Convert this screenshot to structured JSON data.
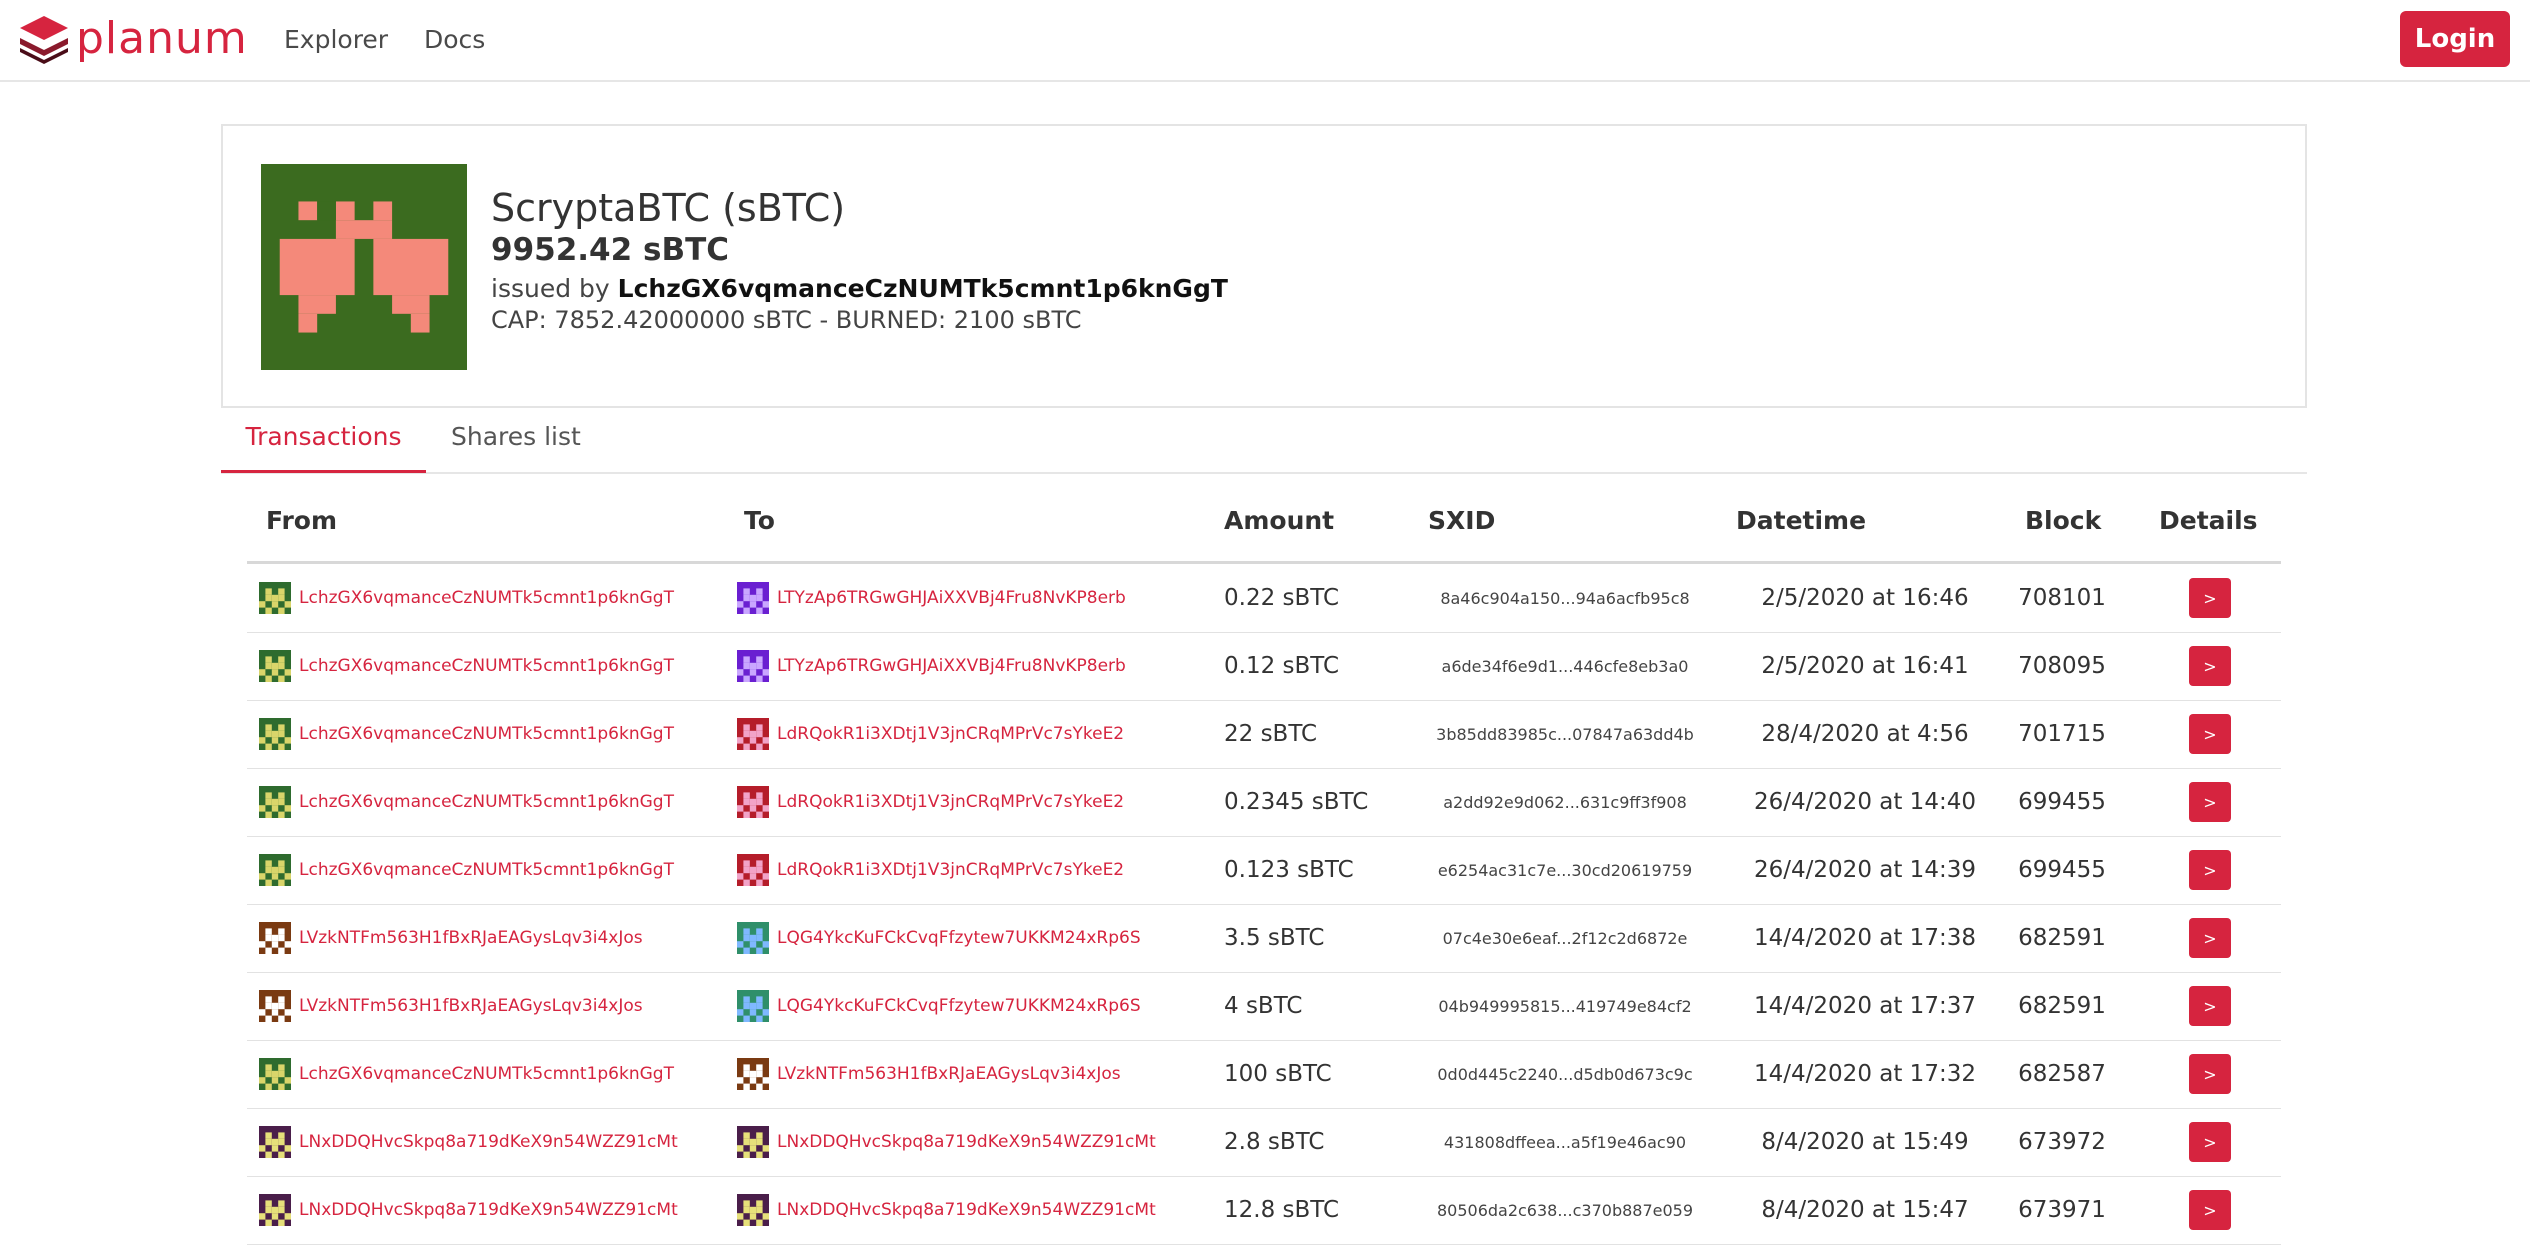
{
  "header": {
    "logo_text": "planum",
    "nav": {
      "explorer": "Explorer",
      "docs": "Docs"
    },
    "login_label": "Login"
  },
  "token": {
    "name": "ScryptaBTC (sBTC)",
    "supply": "9952.42 sBTC",
    "issued_prefix": "issued by",
    "issuer": "LchzGX6vqmanceCzNUMTk5cmnt1p6knGgT",
    "cap_line": "CAP: 7852.42000000 sBTC - BURNED: 2100 sBTC",
    "avatar_colors": {
      "bg": "#3b6b1f",
      "fg": "#f4897a"
    }
  },
  "tabs": {
    "transactions": "Transactions",
    "shares": "Shares list"
  },
  "table": {
    "headers": {
      "from": "From",
      "to": "To",
      "amount": "Amount",
      "sxid": "SXID",
      "datetime": "Datetime",
      "block": "Block",
      "details": "Details"
    },
    "details_glyph": ">",
    "rows": [
      {
        "from": "LchzGX6vqmanceCzNUMTk5cmnt1p6knGgT",
        "from_icon": "green",
        "to": "LTYzAp6TRGwGHJAiXXVBj4Fru8NvKP8erb",
        "to_icon": "purple",
        "amount": "0.22 sBTC",
        "sxid": "8a46c904a150...94a6acfb95c8",
        "datetime": "2/5/2020 at 16:46",
        "block": "708101"
      },
      {
        "from": "LchzGX6vqmanceCzNUMTk5cmnt1p6knGgT",
        "from_icon": "green",
        "to": "LTYzAp6TRGwGHJAiXXVBj4Fru8NvKP8erb",
        "to_icon": "purple",
        "amount": "0.12 sBTC",
        "sxid": "a6de34f6e9d1...446cfe8eb3a0",
        "datetime": "2/5/2020 at 16:41",
        "block": "708095"
      },
      {
        "from": "LchzGX6vqmanceCzNUMTk5cmnt1p6knGgT",
        "from_icon": "green",
        "to": "LdRQokR1i3XDtj1V3jnCRqMPrVc7sYkeE2",
        "to_icon": "red",
        "amount": "22 sBTC",
        "sxid": "3b85dd83985c...07847a63dd4b",
        "datetime": "28/4/2020 at 4:56",
        "block": "701715"
      },
      {
        "from": "LchzGX6vqmanceCzNUMTk5cmnt1p6knGgT",
        "from_icon": "green",
        "to": "LdRQokR1i3XDtj1V3jnCRqMPrVc7sYkeE2",
        "to_icon": "red",
        "amount": "0.2345 sBTC",
        "sxid": "a2dd92e9d062...631c9ff3f908",
        "datetime": "26/4/2020 at 14:40",
        "block": "699455"
      },
      {
        "from": "LchzGX6vqmanceCzNUMTk5cmnt1p6knGgT",
        "from_icon": "green",
        "to": "LdRQokR1i3XDtj1V3jnCRqMPrVc7sYkeE2",
        "to_icon": "red",
        "amount": "0.123 sBTC",
        "sxid": "e6254ac31c7e...30cd20619759",
        "datetime": "26/4/2020 at 14:39",
        "block": "699455"
      },
      {
        "from": "LVzkNTFm563H1fBxRJaEAGysLqv3i4xJos",
        "from_icon": "brown",
        "to": "LQG4YkcKuFCkCvqFfzytew7UKKM24xRp6S",
        "to_icon": "teal",
        "amount": "3.5 sBTC",
        "sxid": "07c4e30e6eaf...2f12c2d6872e",
        "datetime": "14/4/2020 at 17:38",
        "block": "682591"
      },
      {
        "from": "LVzkNTFm563H1fBxRJaEAGysLqv3i4xJos",
        "from_icon": "brown",
        "to": "LQG4YkcKuFCkCvqFfzytew7UKKM24xRp6S",
        "to_icon": "teal",
        "amount": "4 sBTC",
        "sxid": "04b949995815...419749e84cf2",
        "datetime": "14/4/2020 at 17:37",
        "block": "682591"
      },
      {
        "from": "LchzGX6vqmanceCzNUMTk5cmnt1p6knGgT",
        "from_icon": "green",
        "to": "LVzkNTFm563H1fBxRJaEAGysLqv3i4xJos",
        "to_icon": "brown",
        "amount": "100 sBTC",
        "sxid": "0d0d445c2240...d5db0d673c9c",
        "datetime": "14/4/2020 at 17:32",
        "block": "682587"
      },
      {
        "from": "LNxDDQHvcSkpq8a719dKeX9n54WZZ91cMt",
        "from_icon": "plum",
        "to": "LNxDDQHvcSkpq8a719dKeX9n54WZZ91cMt",
        "to_icon": "plum",
        "amount": "2.8 sBTC",
        "sxid": "431808dffeea...a5f19e46ac90",
        "datetime": "8/4/2020 at 15:49",
        "block": "673972"
      },
      {
        "from": "LNxDDQHvcSkpq8a719dKeX9n54WZZ91cMt",
        "from_icon": "plum",
        "to": "LNxDDQHvcSkpq8a719dKeX9n54WZZ91cMt",
        "to_icon": "plum",
        "amount": "12.8 sBTC",
        "sxid": "80506da2c638...c370b887e059",
        "datetime": "8/4/2020 at 15:47",
        "block": "673971"
      }
    ]
  },
  "identicon_palettes": {
    "green": {
      "bg": "#2e6b2e",
      "fg": "#d9d56a"
    },
    "purple": {
      "bg": "#6a1fd1",
      "fg": "#c9a6ff"
    },
    "red": {
      "bg": "#b51d2a",
      "fg": "#f2a3c8"
    },
    "brown": {
      "bg": "#7a3a12",
      "fg": "#ffffff"
    },
    "teal": {
      "bg": "#2f8f6a",
      "fg": "#7fb8ff"
    },
    "plum": {
      "bg": "#4a1e4a",
      "fg": "#e6e07a"
    }
  },
  "brand_color": "#d6243f"
}
